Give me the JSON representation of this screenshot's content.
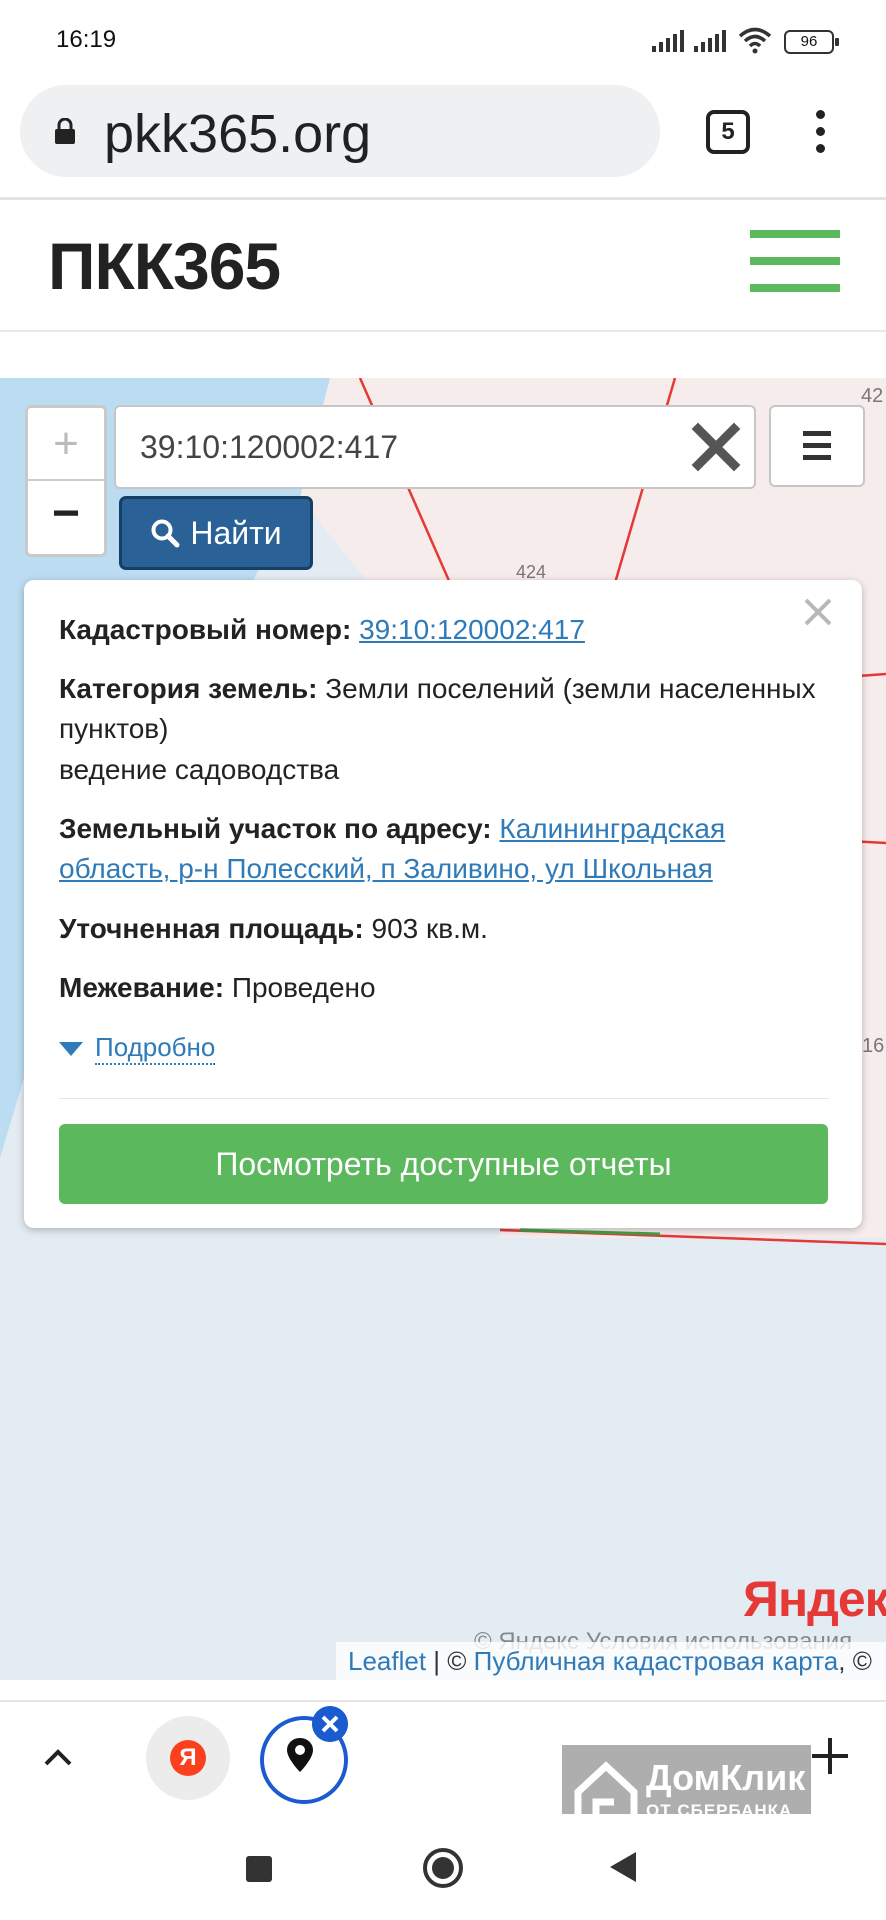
{
  "status_bar": {
    "time": "16:19",
    "battery": "96"
  },
  "browser": {
    "url": "pkk365.org",
    "tab_count": "5"
  },
  "site": {
    "logo": "ПКК365"
  },
  "map": {
    "parcel_labels": [
      "42",
      "424",
      "16"
    ]
  },
  "search": {
    "value": "39:10:120002:417",
    "find_label": "Найти"
  },
  "popup": {
    "cadastral_label": "Кадастровый номер:",
    "cadastral_value": "39:10:120002:417",
    "category_label": "Категория земель:",
    "category_value": "Земли поселений (земли населенных",
    "category_value_2": "пунктов)",
    "usage": "ведение садоводства",
    "address_label": "Земельный участок по адресу:",
    "address_value": "Калининградская",
    "address_value_2": "область, р-н Полесский, п Заливино, ул Школьная",
    "area_label": "Уточненная площадь:",
    "area_value": "903 кв.м.",
    "survey_label": "Межевание:",
    "survey_value": "Проведено",
    "details_link": "Подробно",
    "reports_button": "Посмотреть доступные отчеты"
  },
  "attribution": {
    "yandex_logo": "Яндекс",
    "yandex_terms": "© Яндекс  Условия использования",
    "leaflet": "Leaflet",
    "separator": " | © ",
    "pkk_link": "Публичная кадастровая карта",
    "tail": ", ©"
  },
  "bottom_toolbar": {
    "yandex_badge": "Я",
    "ad_name": "ДомКлик",
    "ad_sub": "ОТ СБЕРБАНКА"
  },
  "colors": {
    "accent_green": "#5cb85c",
    "find_button_blue": "#2a6297",
    "link_blue": "#2f7ab8",
    "parcel_line_red": "#e53935"
  }
}
